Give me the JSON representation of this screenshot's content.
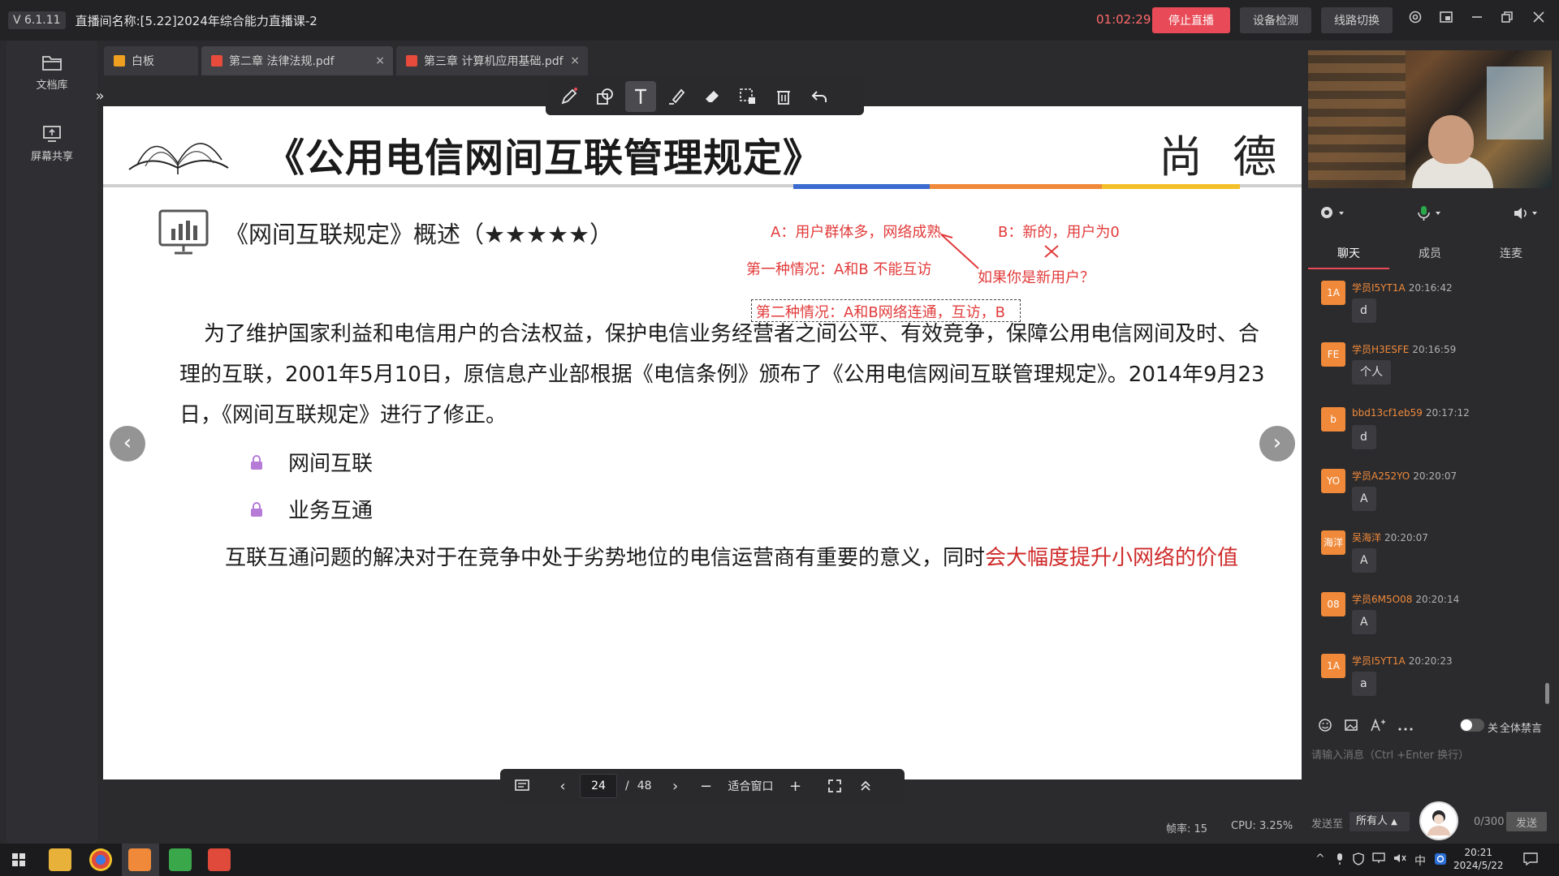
{
  "titlebar": {
    "version": "V 6.1.11",
    "room_title": "直播间名称:[5.22]2024年综合能力直播课-2",
    "timer": "01:02:29",
    "stop_label": "停止直播",
    "device_check_label": "设备检测",
    "line_switch_label": "线路切换"
  },
  "sidebar": {
    "items": [
      {
        "label": "文档库",
        "icon": "folder-icon"
      },
      {
        "label": "屏幕共享",
        "icon": "screen-share-icon"
      }
    ]
  },
  "tabs": [
    {
      "label": "白板",
      "icon_color": "#f0a020"
    },
    {
      "label": "第二章 法律法规.pdf",
      "icon_color": "#e84b3c",
      "close": "×"
    },
    {
      "label": "第三章 计算机应用基础.pdf",
      "icon_color": "#e84b3c",
      "close": "×"
    }
  ],
  "slide": {
    "title": "《公用电信网间互联管理规定》",
    "logo_text": "尚 德",
    "section_head": "《网间互联规定》概述（★★★★★）",
    "para1": "为了维护国家利益和电信用户的合法权益，保护电信业务经营者之间公平、有效竞争，保障公用电信网间及时、合理的互联，2001年5月10日，原信息产业部根据《电信条例》颁布了《公用电信网间互联管理规定》。2014年9月23日，《网间互联规定》进行了修正。",
    "bullets": [
      "网间互联",
      "业务互通"
    ],
    "para2_normal": "互联互通问题的解决对于在竞争中处于劣势地位的电信运营商有重要的意义，同时",
    "para2_red": "会大幅度提升小网络的价值",
    "annotations": {
      "a": "A：用户群体多，网络成熟",
      "b": "B：新的，用户为0",
      "case1": "第一种情况：A和B 不能互访",
      "new_user": "如果你是新用户？",
      "case2": "第二种情况：A和B网络连通，互访，B"
    }
  },
  "pagebar": {
    "current_page": "24",
    "separator": "/",
    "total_pages": "48",
    "fit_label": "适合窗口"
  },
  "status": {
    "fps": "帧率: 15",
    "cpu": "CPU: 3.25%"
  },
  "chat": {
    "tabs": [
      "聊天",
      "成员",
      "连麦"
    ],
    "messages": [
      {
        "avatar": "1A",
        "user": "学员I5YT1A",
        "time": "20:16:42",
        "text": "d"
      },
      {
        "avatar": "FE",
        "user": "学员H3ESFE",
        "time": "20:16:59",
        "text": "个人"
      },
      {
        "avatar": "b",
        "user": "bbd13cf1eb59",
        "time": "20:17:12",
        "text": "d"
      },
      {
        "avatar": "YO",
        "user": "学员A252YO",
        "time": "20:20:07",
        "text": "A"
      },
      {
        "avatar": "海洋",
        "user": "吴海洋",
        "time": "20:20:07",
        "text": "A"
      },
      {
        "avatar": "08",
        "user": "学员6M5O08",
        "time": "20:20:14",
        "text": "A"
      },
      {
        "avatar": "1A",
        "user": "学员I5YT1A",
        "time": "20:20:23",
        "text": "a"
      }
    ],
    "toggle_label": "关",
    "mute_all_label": "全体禁言",
    "input_placeholder": "请输入消息（Ctrl +Enter 换行）",
    "send_to_label": "发送至",
    "send_to_value": "所有人",
    "char_count": "0/300",
    "send_label": "发送"
  },
  "taskbar": {
    "time": "20:21",
    "date": "2024/5/22",
    "ime": "中"
  },
  "colors": {
    "accent": "#e84b57",
    "username": "#f08a3a",
    "annotation": "#e23b3b"
  }
}
